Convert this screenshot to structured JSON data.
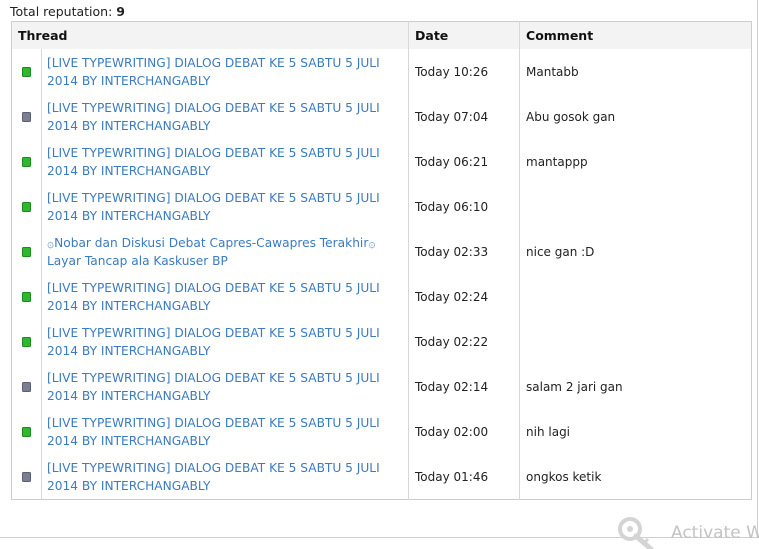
{
  "total": {
    "label": "Total reputation:",
    "value": "9"
  },
  "table": {
    "headers": {
      "thread": "Thread",
      "date": "Date",
      "comment": "Comment"
    },
    "rows": [
      {
        "status": "green",
        "thread": "[LIVE TYPEWRITING] DIALOG DEBAT KE 5 SABTU 5 JULI 2014 BY INTERCHANGABLY",
        "date": "Today 10:26",
        "comment": "Mantabb"
      },
      {
        "status": "gray",
        "thread": "[LIVE TYPEWRITING] DIALOG DEBAT KE 5 SABTU 5 JULI 2014 BY INTERCHANGABLY",
        "date": "Today 07:04",
        "comment": "Abu gosok gan"
      },
      {
        "status": "green",
        "thread": "[LIVE TYPEWRITING] DIALOG DEBAT KE 5 SABTU 5 JULI 2014 BY INTERCHANGABLY",
        "date": "Today 06:21",
        "comment": "mantappp"
      },
      {
        "status": "green",
        "thread": "[LIVE TYPEWRITING] DIALOG DEBAT KE 5 SABTU 5 JULI 2014 BY INTERCHANGABLY",
        "date": "Today 06:10",
        "comment": ""
      },
      {
        "status": "green",
        "thread": "۞Nobar dan Diskusi Debat Capres-Cawapres Terakhir۞ Layar Tancap ala Kaskuser BP",
        "date": "Today 02:33",
        "comment": "nice gan :D"
      },
      {
        "status": "green",
        "thread": "[LIVE TYPEWRITING] DIALOG DEBAT KE 5 SABTU 5 JULI 2014 BY INTERCHANGABLY",
        "date": "Today 02:24",
        "comment": ""
      },
      {
        "status": "green",
        "thread": "[LIVE TYPEWRITING] DIALOG DEBAT KE 5 SABTU 5 JULI 2014 BY INTERCHANGABLY",
        "date": "Today 02:22",
        "comment": ""
      },
      {
        "status": "gray",
        "thread": "[LIVE TYPEWRITING] DIALOG DEBAT KE 5 SABTU 5 JULI 2014 BY INTERCHANGABLY",
        "date": "Today 02:14",
        "comment": "salam 2 jari gan"
      },
      {
        "status": "green",
        "thread": "[LIVE TYPEWRITING] DIALOG DEBAT KE 5 SABTU 5 JULI 2014 BY INTERCHANGABLY",
        "date": "Today 02:00",
        "comment": "nih lagi"
      },
      {
        "status": "gray",
        "thread": "[LIVE TYPEWRITING] DIALOG DEBAT KE 5 SABTU 5 JULI 2014 BY INTERCHANGABLY",
        "date": "Today 01:46",
        "comment": "ongkos ketik"
      }
    ]
  },
  "watermark": {
    "text": "Activate W",
    "icon": "key-icon"
  },
  "colors": {
    "link": "#3b7bbf",
    "positive": "#2db82d",
    "neutral": "#7c7f93",
    "header_bg": "#f3f3f3"
  }
}
